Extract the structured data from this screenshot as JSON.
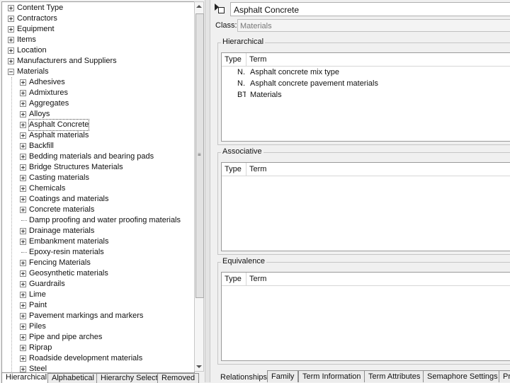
{
  "tree": {
    "items": [
      {
        "label": "Content Type",
        "level": 0,
        "icon": "plus"
      },
      {
        "label": "Contractors",
        "level": 0,
        "icon": "plus"
      },
      {
        "label": "Equipment",
        "level": 0,
        "icon": "plus"
      },
      {
        "label": "Items",
        "level": 0,
        "icon": "plus"
      },
      {
        "label": "Location",
        "level": 0,
        "icon": "plus"
      },
      {
        "label": "Manufacturers and Suppliers",
        "level": 0,
        "icon": "plus"
      },
      {
        "label": "Materials",
        "level": 0,
        "icon": "minus"
      },
      {
        "label": "Adhesives",
        "level": 1,
        "icon": "plus"
      },
      {
        "label": "Admixtures",
        "level": 1,
        "icon": "plus"
      },
      {
        "label": "Aggregates",
        "level": 1,
        "icon": "plus"
      },
      {
        "label": "Alloys",
        "level": 1,
        "icon": "plus"
      },
      {
        "label": "Asphalt Concrete",
        "level": 1,
        "icon": "plus",
        "selected": true
      },
      {
        "label": "Asphalt materials",
        "level": 1,
        "icon": "plus"
      },
      {
        "label": "Backfill",
        "level": 1,
        "icon": "plus"
      },
      {
        "label": "Bedding materials and bearing pads",
        "level": 1,
        "icon": "plus"
      },
      {
        "label": "Bridge Structures Materials",
        "level": 1,
        "icon": "plus"
      },
      {
        "label": "Casting materials",
        "level": 1,
        "icon": "plus"
      },
      {
        "label": "Chemicals",
        "level": 1,
        "icon": "plus"
      },
      {
        "label": "Coatings and materials",
        "level": 1,
        "icon": "plus"
      },
      {
        "label": "Concrete materials",
        "level": 1,
        "icon": "plus"
      },
      {
        "label": "Damp proofing and water proofing materials",
        "level": 1,
        "icon": "none"
      },
      {
        "label": "Drainage materials",
        "level": 1,
        "icon": "plus"
      },
      {
        "label": "Embankment materials",
        "level": 1,
        "icon": "plus"
      },
      {
        "label": "Epoxy-resin materials",
        "level": 1,
        "icon": "none"
      },
      {
        "label": "Fencing Materials",
        "level": 1,
        "icon": "plus"
      },
      {
        "label": "Geosynthetic materials",
        "level": 1,
        "icon": "plus"
      },
      {
        "label": "Guardrails",
        "level": 1,
        "icon": "plus"
      },
      {
        "label": "Lime",
        "level": 1,
        "icon": "plus"
      },
      {
        "label": "Paint",
        "level": 1,
        "icon": "plus"
      },
      {
        "label": "Pavement markings and markers",
        "level": 1,
        "icon": "plus"
      },
      {
        "label": "Piles",
        "level": 1,
        "icon": "plus"
      },
      {
        "label": "Pipe and pipe arches",
        "level": 1,
        "icon": "plus"
      },
      {
        "label": "Riprap",
        "level": 1,
        "icon": "plus"
      },
      {
        "label": "Roadside development materials",
        "level": 1,
        "icon": "plus"
      },
      {
        "label": "Steel",
        "level": 1,
        "icon": "plus"
      }
    ]
  },
  "left_tabs": [
    "Hierarchical",
    "Alphabetical",
    "Hierarchy Select",
    "Removed"
  ],
  "detail": {
    "term": "Asphalt Concrete",
    "class_label": "Class:",
    "class_value": "Materials"
  },
  "groups": {
    "hierarchical": {
      "title": "Hierarchical",
      "columns": {
        "type": "Type",
        "term": "Term"
      },
      "rows": [
        {
          "type": "N..",
          "term": "Asphalt concrete mix type"
        },
        {
          "type": "N..",
          "term": "Asphalt concrete pavement materials"
        },
        {
          "type": "BT",
          "term": "Materials"
        }
      ]
    },
    "associative": {
      "title": "Associative",
      "columns": {
        "type": "Type",
        "term": "Term"
      },
      "rows": []
    },
    "equivalence": {
      "title": "Equivalence",
      "columns": {
        "type": "Type",
        "term": "Term"
      },
      "rows": []
    }
  },
  "right_tabs": [
    "Relationships",
    "Family",
    "Term Information",
    "Term Attributes",
    "Semaphore Settings",
    "Pr"
  ]
}
